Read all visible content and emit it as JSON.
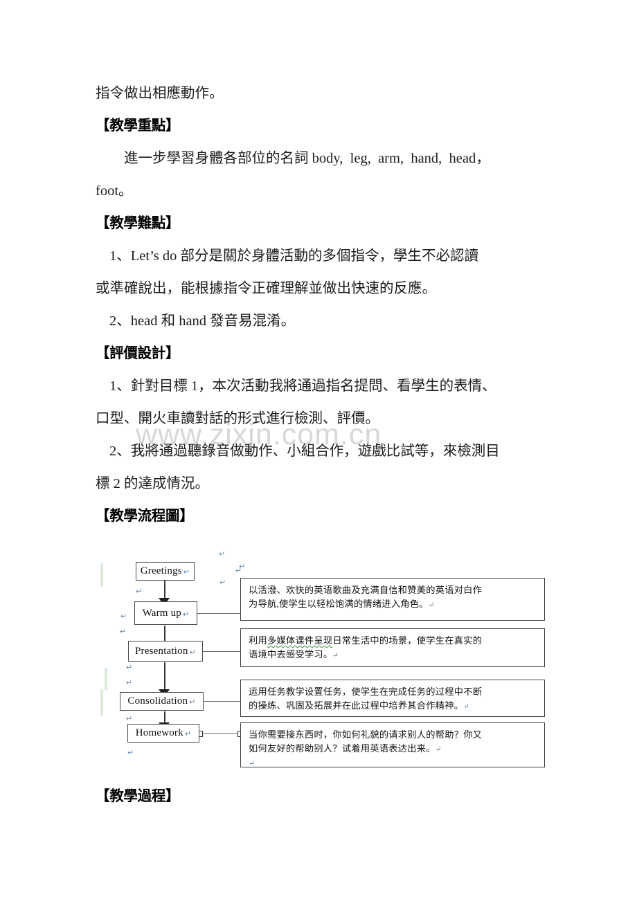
{
  "document": {
    "watermark": "www.zixin.com.cn",
    "paragraphs": [
      {
        "id": "p-intro-cont",
        "text": "指令做出相應動作。"
      }
    ],
    "sections": [
      {
        "heading": "【教學重點】",
        "lines": [
          "進一步學習身體各部位的名詞 body,  leg,  arm,  hand,  head，",
          "foot。"
        ]
      },
      {
        "heading": "【教學難點】",
        "lines": [
          "1、Let’s do 部分是關於身體活動的多個指令，學生不必認讀",
          "或準確說出，能根據指令正確理解並做出快速的反應。",
          "2、head 和 hand 發音易混淆。"
        ]
      },
      {
        "heading": "【評價設計】",
        "lines": [
          "1、針對目標 1，本次活動我將通過指名提問、看學生的表情、",
          "口型、開火車讀對話的形式進行檢測、評價。",
          "2、我將通過聽錄音做動作、小組合作，遊戲比試等，來檢測目",
          "標 2 的達成情況。"
        ]
      },
      {
        "heading": "【教學流程圖】",
        "lines": []
      },
      {
        "heading": "【教學過程】",
        "lines": []
      }
    ]
  },
  "flowchart": {
    "pilcrow": "↵",
    "stages": [
      {
        "id": "greetings",
        "label": "Greetings"
      },
      {
        "id": "warm-up",
        "label": "Warm up"
      },
      {
        "id": "presentation",
        "label": "Presentation"
      },
      {
        "id": "consolidation",
        "label": "Consolidation"
      },
      {
        "id": "homework",
        "label": "Homework"
      }
    ],
    "callouts": [
      {
        "id": "callout-warm-up",
        "for": "warm-up",
        "line1": "以活潑、欢快的英语歌曲及充满自信和赞美的英语对白作",
        "line2": "为导航,使学生以轻松饱满的情绪进入角色。"
      },
      {
        "id": "callout-presentation",
        "for": "presentation",
        "line1_a": "利用",
        "line1_squiggle": "多媒体课件呈现",
        "line1_b": "日常生活中的场景，使学生在真实的",
        "line2": "语境中去感受学习。"
      },
      {
        "id": "callout-consolidation",
        "for": "consolidation",
        "line1": "运用任务教学设置任务，使学生在完成任务的过程中不断",
        "line2": "的操练、巩固及拓展并在此过程中培养其合作精神。"
      },
      {
        "id": "callout-homework",
        "for": "homework",
        "line1": "当你需要接东西时，你如何礼貌的请求别人的帮助？你又",
        "line2": "如何友好的帮助别人？试着用英语表达出来。"
      }
    ]
  }
}
